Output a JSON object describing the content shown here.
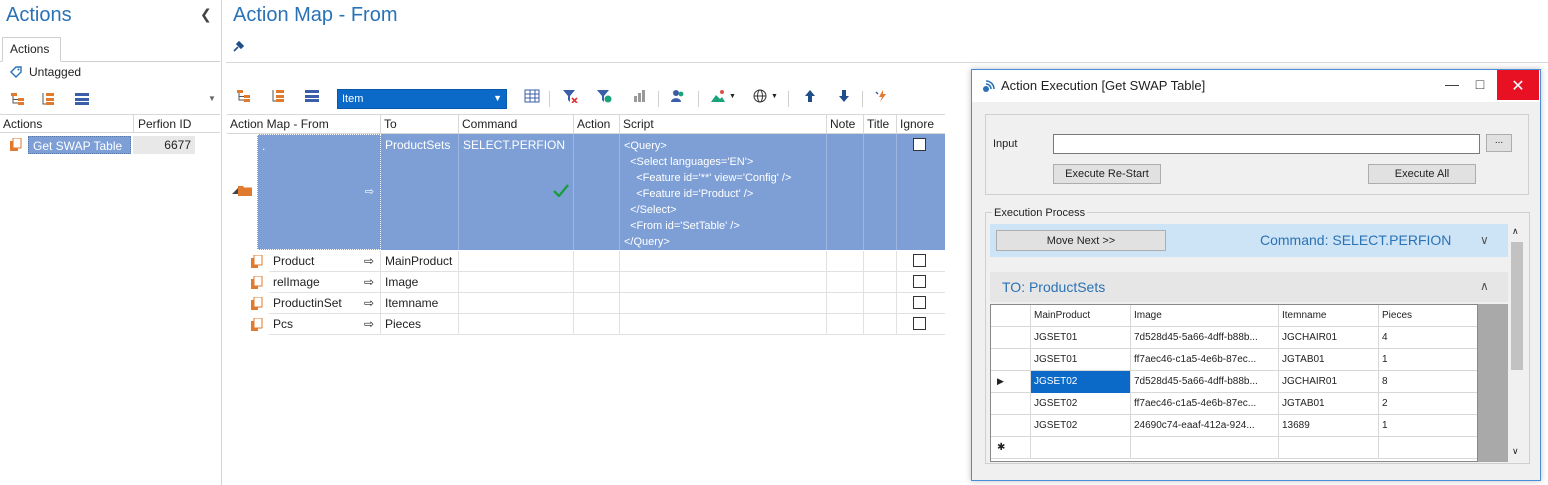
{
  "left": {
    "title": "Actions",
    "tab": "Actions",
    "untagged": "Untagged",
    "grid": {
      "headers": [
        "Actions",
        "Perfion ID"
      ],
      "rows": [
        {
          "name": "Get SWAP Table",
          "id": "6677"
        }
      ]
    }
  },
  "main": {
    "title": "Action Map - From",
    "toolbar": {
      "combo_value": "Item"
    },
    "grid": {
      "headers": [
        "Action Map - From",
        "To",
        "Command",
        "Action",
        "Script",
        "Note",
        "Title",
        "Ignore"
      ],
      "main_row": {
        "from": ".",
        "to": "ProductSets",
        "command": "SELECT.PERFION",
        "script_lines": [
          "<Query>",
          "  <Select languages='EN'>",
          "    <Feature id='**' view='Config' />",
          "    <Feature id='Product' />",
          "  </Select>",
          "  <From id='SetTable' />",
          "</Query>"
        ]
      },
      "sub_rows": [
        {
          "from": "Product",
          "to": "MainProduct"
        },
        {
          "from": "relImage",
          "to": "Image"
        },
        {
          "from": "ProductinSet",
          "to": "Itemname"
        },
        {
          "from": "Pcs",
          "to": "Pieces"
        }
      ]
    }
  },
  "dialog": {
    "title": "Action Execution [Get SWAP Table]",
    "input_label": "Input",
    "input_value": "",
    "dots_label": "...",
    "restart_label": "Execute Re-Start",
    "execute_all_label": "Execute All",
    "process_label": "Execution Process",
    "move_next_label": "Move Next >>",
    "command_text": "Command: SELECT.PERFION",
    "to_text": "TO: ProductSets",
    "table": {
      "headers": [
        "MainProduct",
        "Image",
        "Itemname",
        "Pieces"
      ],
      "rows": [
        [
          "JGSET01",
          "7d528d45-5a66-4dff-b88b...",
          "JGCHAIR01",
          "4"
        ],
        [
          "JGSET01",
          "ff7aec46-c1a5-4e6b-87ec...",
          "JGTAB01",
          "1"
        ],
        [
          "JGSET02",
          "7d528d45-5a66-4dff-b88b...",
          "JGCHAIR01",
          "8"
        ],
        [
          "JGSET02",
          "ff7aec46-c1a5-4e6b-87ec...",
          "JGTAB01",
          "2"
        ],
        [
          "JGSET02",
          "24690c74-eaaf-412a-924...",
          "13689",
          "1"
        ]
      ],
      "selected_row": 2
    }
  },
  "colors": {
    "accent": "#2a72b5",
    "selection": "#7d9fd6",
    "combo": "#0b6ac7",
    "close": "#e81123"
  }
}
